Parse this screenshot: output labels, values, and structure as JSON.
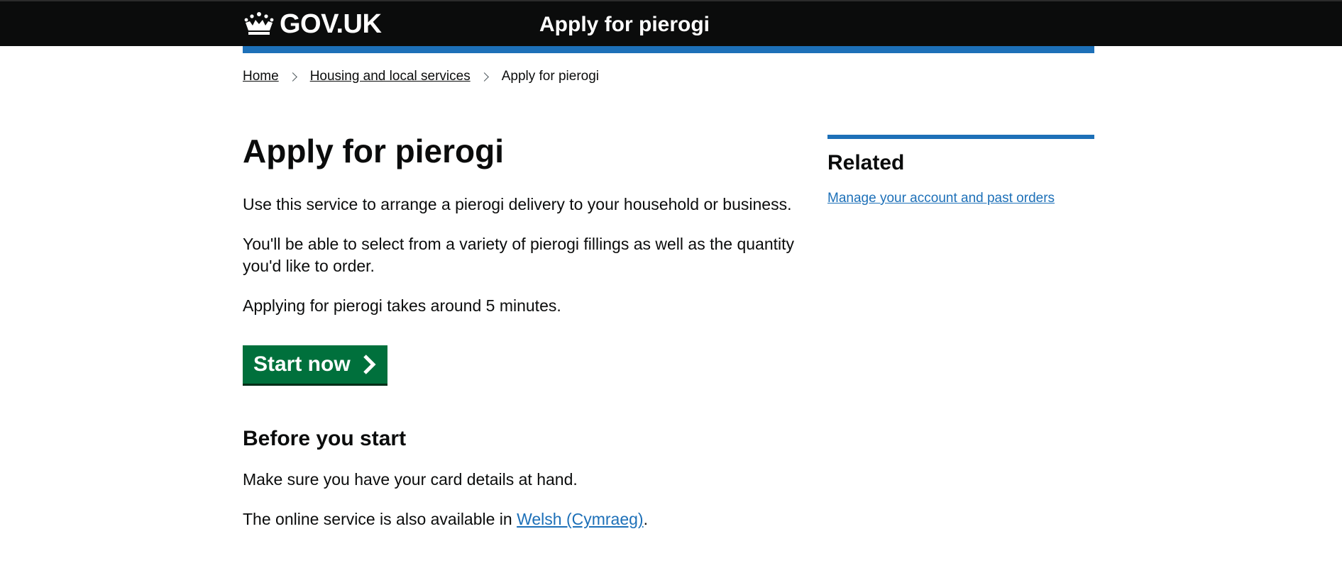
{
  "header": {
    "logo_text": "GOV.UK",
    "service_name": "Apply for pierogi"
  },
  "breadcrumbs": [
    {
      "label": "Home"
    },
    {
      "label": "Housing and local services"
    },
    {
      "label": "Apply for pierogi"
    }
  ],
  "main": {
    "title": "Apply for pierogi",
    "paragraphs": [
      "Use this service to arrange a pierogi delivery to your household or business.",
      "You'll be able to select from a variety of pierogi fillings as well as the quantity you'd like to order.",
      "Applying for pierogi takes around 5 minutes."
    ],
    "start_button": "Start now",
    "before_heading": "Before you start",
    "before_paragraph": "Make sure you have your card details at hand.",
    "welsh_prefix": "The online service is also available in ",
    "welsh_link": "Welsh (Cymraeg)",
    "welsh_suffix": "."
  },
  "related": {
    "title": "Related",
    "link": "Manage your account and past orders"
  },
  "colors": {
    "header_bg": "#0b0c0c",
    "brand_blue": "#1d70b8",
    "start_green": "#00703c",
    "text": "#0b0c0c"
  },
  "icons": [
    "crown-icon",
    "chevron-right-icon",
    "breadcrumb-separator-icon"
  ]
}
